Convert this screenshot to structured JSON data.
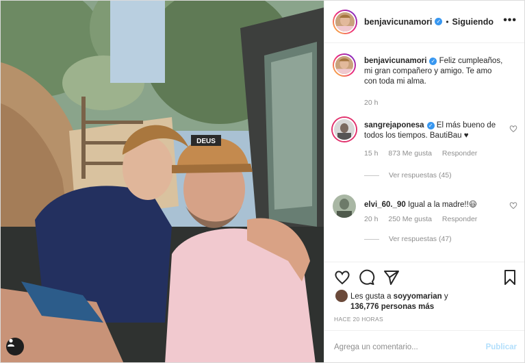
{
  "post": {
    "username": "benjavicunamori",
    "follow_status": "Siguiendo",
    "more_label": "•••"
  },
  "caption": {
    "username": "benjavicunamori",
    "text": "Feliz cumpleaños, mi gran compañero y amigo. Te amo con toda mi alma.",
    "time": "20 h"
  },
  "comments": [
    {
      "username": "sangrejaponesa",
      "verified": true,
      "text": "El más bueno de todos los tiempos. BautiBau ♥",
      "time": "15 h",
      "likes": "873 Me gusta",
      "reply_label": "Responder",
      "view_replies": "Ver respuestas (45)"
    },
    {
      "username": "elvi_60._90",
      "verified": false,
      "text": "Igual a la madre!!😃",
      "time": "20 h",
      "likes": "250 Me gusta",
      "reply_label": "Responder",
      "view_replies": "Ver respuestas (47)"
    }
  ],
  "photo": {
    "cap_text": "DEUS"
  },
  "likes": {
    "line1_prefix": "Les gusta a",
    "liker": "soyyomarian",
    "line1_suffix": "y",
    "line2_count": "136,776 personas más"
  },
  "timestamp": "HACE 20 HORAS",
  "add_comment": {
    "placeholder": "Agrega un comentario...",
    "publish_label": "Publicar"
  },
  "icons": {
    "more": "more-options-icon",
    "verified": "verified-badge-icon",
    "heart": "heart-icon",
    "comment": "comment-icon",
    "share": "share-icon",
    "save": "bookmark-icon",
    "tag": "user-tag-icon"
  },
  "colors": {
    "verified": "#3897f0",
    "publish_disabled": "#b2dffc",
    "muted_text": "#8e8e8e"
  }
}
